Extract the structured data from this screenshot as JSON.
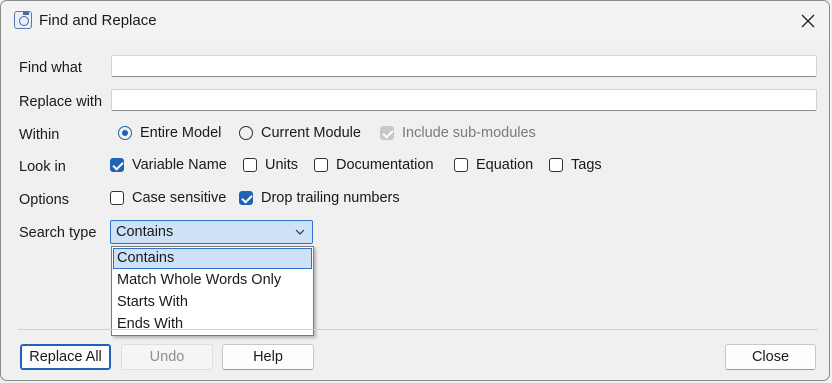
{
  "window": {
    "title": "Find and Replace"
  },
  "fields": {
    "find_label": "Find what",
    "find_value": "",
    "replace_label": "Replace with",
    "replace_value": ""
  },
  "within": {
    "label": "Within",
    "options": [
      {
        "label": "Entire Model",
        "checked": true
      },
      {
        "label": "Current Module",
        "checked": false
      }
    ],
    "include_submodules": {
      "label": "Include sub-modules",
      "checked": true,
      "enabled": false
    }
  },
  "look_in": {
    "label": "Look in",
    "options": [
      {
        "label": "Variable Name",
        "checked": true
      },
      {
        "label": "Units",
        "checked": false
      },
      {
        "label": "Documentation",
        "checked": false
      },
      {
        "label": "Equation",
        "checked": false
      },
      {
        "label": "Tags",
        "checked": false
      }
    ]
  },
  "options": {
    "label": "Options",
    "items": [
      {
        "label": "Case sensitive",
        "checked": false
      },
      {
        "label": "Drop trailing numbers",
        "checked": true
      }
    ]
  },
  "search_type": {
    "label": "Search type",
    "selected": "Contains",
    "options": [
      "Contains",
      "Match Whole Words Only",
      "Starts With",
      "Ends With"
    ]
  },
  "buttons": {
    "replace_all": "Replace All",
    "undo": "Undo",
    "help": "Help",
    "close": "Close"
  },
  "colors": {
    "accent": "#1f63b7",
    "selection": "#cde1f7"
  }
}
